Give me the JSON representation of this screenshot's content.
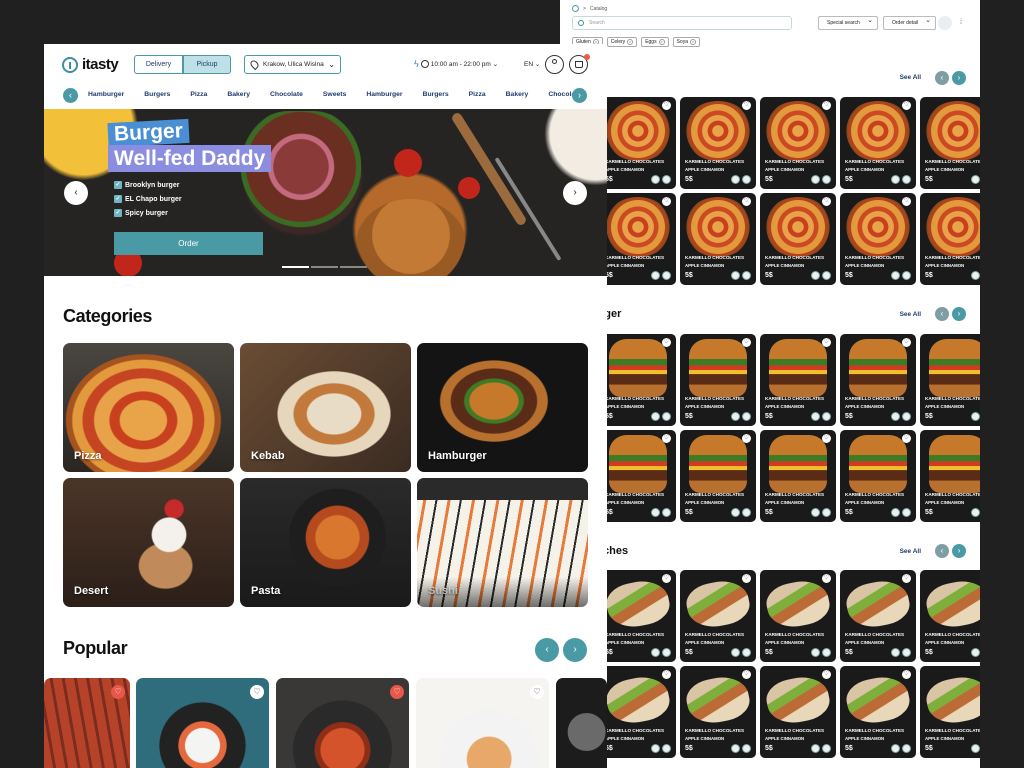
{
  "catalog": {
    "breadcrumb": "Catalog",
    "search_placeholder": "Search",
    "allergen_chips": [
      "Gluten",
      "Celery",
      "Eggs",
      "Soya"
    ],
    "special_search": "Special search",
    "order_detail": "Order detail",
    "see_all": "See All",
    "sections": [
      {
        "title": "",
        "kind": "pizza"
      },
      {
        "title": "rger",
        "kind": "burger"
      },
      {
        "title": "iches",
        "kind": "wrap"
      }
    ],
    "product": {
      "name": "KARMELLO CHOCOLATES",
      "subtitle": "APPLE CINNAMON",
      "price": "5$"
    }
  },
  "header": {
    "brand": "itasty",
    "delivery": "Delivery",
    "pickup": "Pickup",
    "address": "Krakow, Ulica Wislna",
    "hours": "10:00 am - 22:00 pm",
    "language": "EN"
  },
  "category_nav": [
    "Hamburger",
    "Burgers",
    "Pizza",
    "Bakery",
    "Chocolate",
    "Sweets",
    "Hamburger",
    "Burgers",
    "Pizza",
    "Bakery",
    "Chocolate"
  ],
  "hero": {
    "title_line1": "Burger",
    "title_line2": "Well-fed Daddy",
    "items": [
      "Brooklyn burger",
      "EL Chapo burger",
      "Spicy burger"
    ],
    "order_label": "Order"
  },
  "categories_title": "Categories",
  "categories": [
    "Pizza",
    "Kebab",
    "Hamburger",
    "Desert",
    "Pasta",
    "Sushi"
  ],
  "popular_title": "Popular",
  "colors": {
    "accent": "#4a9aa6",
    "navy": "#1f3b6e",
    "heart_red": "#e8574a"
  }
}
